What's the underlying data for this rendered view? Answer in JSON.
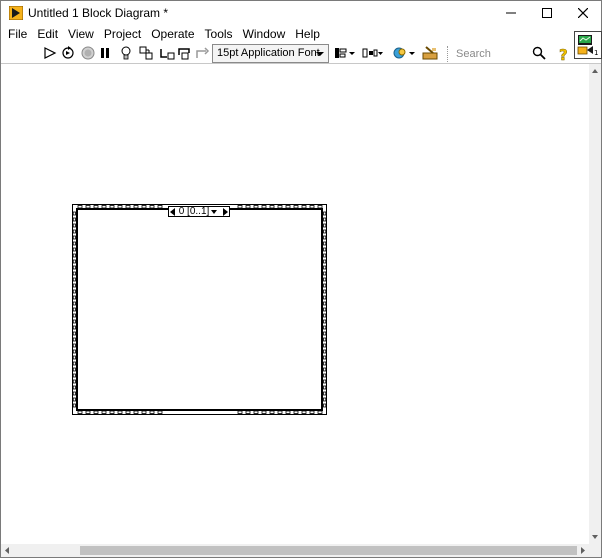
{
  "window": {
    "title": "Untitled 1 Block Diagram *"
  },
  "menu": {
    "items": [
      "File",
      "Edit",
      "View",
      "Project",
      "Operate",
      "Tools",
      "Window",
      "Help"
    ]
  },
  "toolbar": {
    "font_label": "15pt Application Font",
    "search_placeholder": "Search"
  },
  "sequence": {
    "frame_label": "0 [0..1]"
  },
  "colors": {
    "accent_orange": "#f5a623",
    "run_arrow": "#000000",
    "abort_red": "#c0392b"
  }
}
